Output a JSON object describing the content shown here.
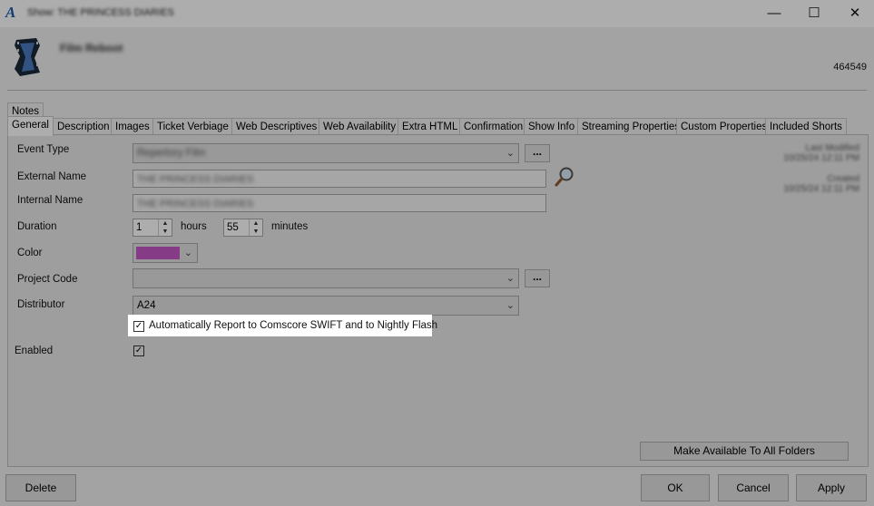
{
  "window": {
    "title": "Show: THE PRINCESS DIARIES",
    "minimize": "—",
    "maximize": "☐",
    "close": "✕"
  },
  "header": {
    "title": "Film Reboot",
    "id": "464549"
  },
  "tabs_row1": [
    {
      "label": "Notes"
    }
  ],
  "tabs_row2": [
    {
      "label": "General",
      "active": true
    },
    {
      "label": "Description"
    },
    {
      "label": "Images"
    },
    {
      "label": "Ticket Verbiage"
    },
    {
      "label": "Web Descriptives"
    },
    {
      "label": "Web Availability"
    },
    {
      "label": "Extra HTML"
    },
    {
      "label": "Confirmation"
    },
    {
      "label": "Show Info"
    },
    {
      "label": "Streaming Properties"
    },
    {
      "label": "Custom Properties"
    },
    {
      "label": "Included Shorts"
    }
  ],
  "form": {
    "event_type_label": "Event Type",
    "event_type_value": "Repertory Film",
    "external_name_label": "External Name",
    "external_name_value": "THE PRINCESS DIARIES",
    "internal_name_label": "Internal Name",
    "internal_name_value": "THE PRINCESS DIARIES",
    "duration_label": "Duration",
    "hours_value": "1",
    "hours_label": "hours",
    "minutes_value": "55",
    "minutes_label": "minutes",
    "color_label": "Color",
    "color_value": "#c658c6",
    "project_code_label": "Project Code",
    "project_code_value": "",
    "distributor_label": "Distributor",
    "distributor_value": "A24",
    "comscore_label": "Automatically Report to Comscore SWIFT and to Nightly Flash",
    "comscore_checked": true,
    "enabled_label": "Enabled",
    "enabled_checked": true,
    "ellipsis": "..."
  },
  "side_info": {
    "last_modified_label": "Last Modified",
    "last_modified_value": "10/25/24 12:11 PM",
    "created_label": "Created",
    "created_value": "10/25/24 12:11 PM"
  },
  "buttons": {
    "make_available": "Make Available To All Folders",
    "delete": "Delete",
    "ok": "OK",
    "cancel": "Cancel",
    "apply": "Apply"
  },
  "checkmark": "✓"
}
